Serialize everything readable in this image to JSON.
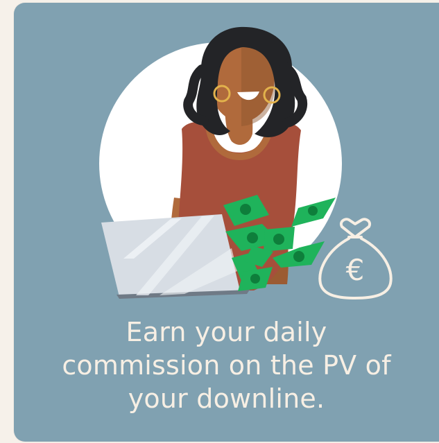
{
  "card": {
    "background": "#80a1b1",
    "caption_lines": [
      "Earn your daily",
      "commission on the PV of",
      "your downline."
    ]
  },
  "illustration": {
    "subject": "woman-with-laptop-and-flying-banknotes",
    "icons": [
      "money-bag-icon",
      "euro-sign-icon",
      "banknote-icon",
      "laptop-icon"
    ],
    "money_bag_symbol": "€",
    "colors": {
      "circle": "#ffffff",
      "skin": "#b06a3c",
      "top": "#a64f3b",
      "hair": "#232427",
      "laptop": "#d7dde4",
      "banknote": "#1fb35b",
      "line": "#f7efe4"
    }
  }
}
